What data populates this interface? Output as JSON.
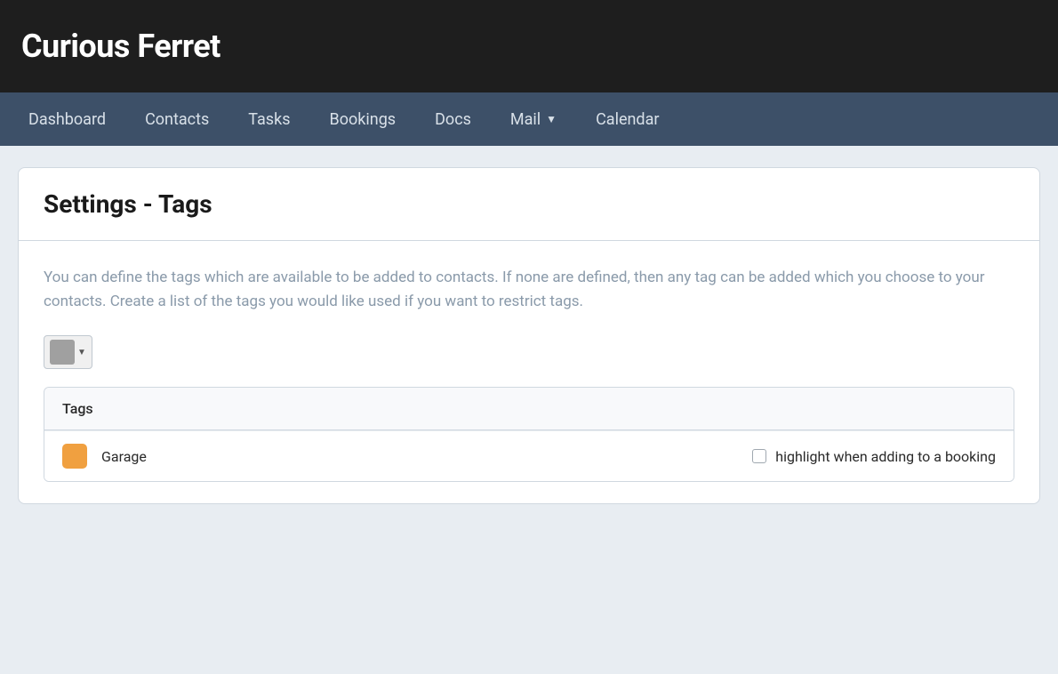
{
  "app": {
    "title": "Curious Ferret"
  },
  "nav": {
    "items": [
      {
        "label": "Dashboard",
        "id": "dashboard",
        "has_dropdown": false
      },
      {
        "label": "Contacts",
        "id": "contacts",
        "has_dropdown": false
      },
      {
        "label": "Tasks",
        "id": "tasks",
        "has_dropdown": false
      },
      {
        "label": "Bookings",
        "id": "bookings",
        "has_dropdown": false
      },
      {
        "label": "Docs",
        "id": "docs",
        "has_dropdown": false
      },
      {
        "label": "Mail",
        "id": "mail",
        "has_dropdown": true
      },
      {
        "label": "Calendar",
        "id": "calendar",
        "has_dropdown": false
      }
    ]
  },
  "settings_tags": {
    "title": "Settings - Tags",
    "description": "You can define the tags which are available to be added to contacts. If none are de... you choose to your contacts. Create a list of the tags you would like used if you wa...",
    "description_full": "You can define the tags which are available to be added to contacts. If none are defined, then any tag can be added which you choose to your contacts. Create a list of the tags you would like used if you want to restrict tags.",
    "table_header": "Tags",
    "color_picker_color": "#a0a0a0",
    "tags": [
      {
        "id": "garage",
        "name": "Garage",
        "color": "#f0a040",
        "highlight_label": "highlight when adding to a booking",
        "highlight_checked": false
      }
    ]
  }
}
